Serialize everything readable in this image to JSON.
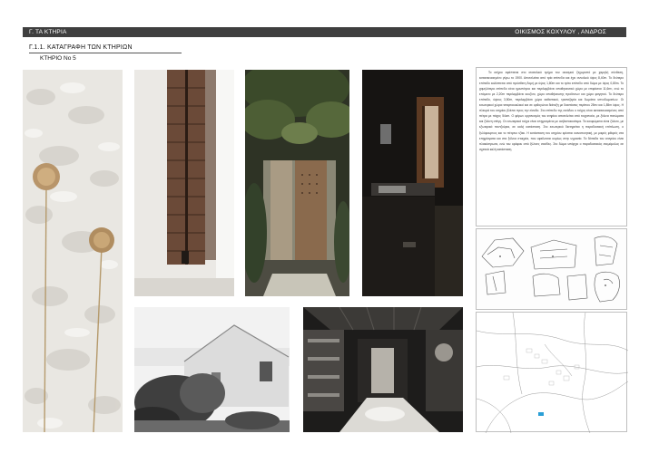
{
  "header": {
    "left_label": "Γ. ΤΑ ΚΤΗΡΙΑ",
    "right_label": "ΟΙΚΙΣΜΟΣ ΚΟΧΥΛΟΥ , ΑΝΔΡΟΣ"
  },
  "section": {
    "title": "Γ.1.1. ΚΑΤΑΓΡΑΦΗ ΤΩΝ ΚΤΗΡΙΩΝ",
    "building_label": "ΚΤΗΡΙΟ Νο 5"
  },
  "description": "Το κτήριο εφάπτεται στο ανατολικό τμήμα του οικισμού ξεχωριστό με χαμηλή σύνθεση, κατασκευασμένο γύρω το 1900. Αποτελείται από τρία επίπεδα και έχει συνολικό ύψος 8,40m. Το δεύτερο επίπεδο καλύπτεται από πρόσθετη δομή με ύψος 1,80m και το τρίτο επίπεδο από δώμα με ύψος 0,80m. Το χαμηλότερο επίπεδο είναι ημιυπόγειο και περιλαμβάνει αποθηκευτικό χώρο με επιφάνεια 11,6m², ενώ το επόμενο με 2,20m περιλαμβάνει κουζίνα, χώρο αποθήκευσης προϊόντων και χώρο φαγητού. Το δεύτερο επίπεδο, ύψους 3,50m, περιλαμβάνει χώρο καθιστικού, τραπεζαρία και δωμάτια υπνοδωματίων. Οι εσωτερικοί χώροι τεταρτοκυκλικοί και σε ορθογώνια διάταξη με διαστάσεις περίπου 25m² και 1,85m ύψος. Η πλευρά του κτηρίου βλέπει προς την είσοδο. Στο επίπεδο της εισόδου ο τοίχος είναι κατασκευασμένος από πέτρα με πάχος 54cm. Ο φέρων οργανισμός του κτηρίου αποτελείται από τοιχοποιία, με ξύλινα πατώματα και ξύλινη στέγη. Οι εσωτερικοί τοίχοι είναι επιχρισμένοι με ασβεστοκονίαμα. Τα κουφώματα είναι ξύλινα, με εξωτερικά παντζούρια, σε καλή κατάσταση. Στο εσωτερικό διατηρείται η παραδοσιακή επίπλωση, ο ξυλόφουρνος και το πέτρινο τζάκι. Η κατάσταση του κτηρίου κρίνεται ικανοποιητική, με μικρές φθορές στα επιχρίσματα και στα ξύλινα στοιχεία, που οφείλονται κυρίως στην υγρασία. Τα δάπεδα του ισογείου είναι πλακόστρωτα, ενώ του ορόφου από ξύλινες σανίδες. Στο δώμα υπάρχει ο παραδοσιακός ανεμόμυλος σε σχετικά καλή κατάσταση."
}
